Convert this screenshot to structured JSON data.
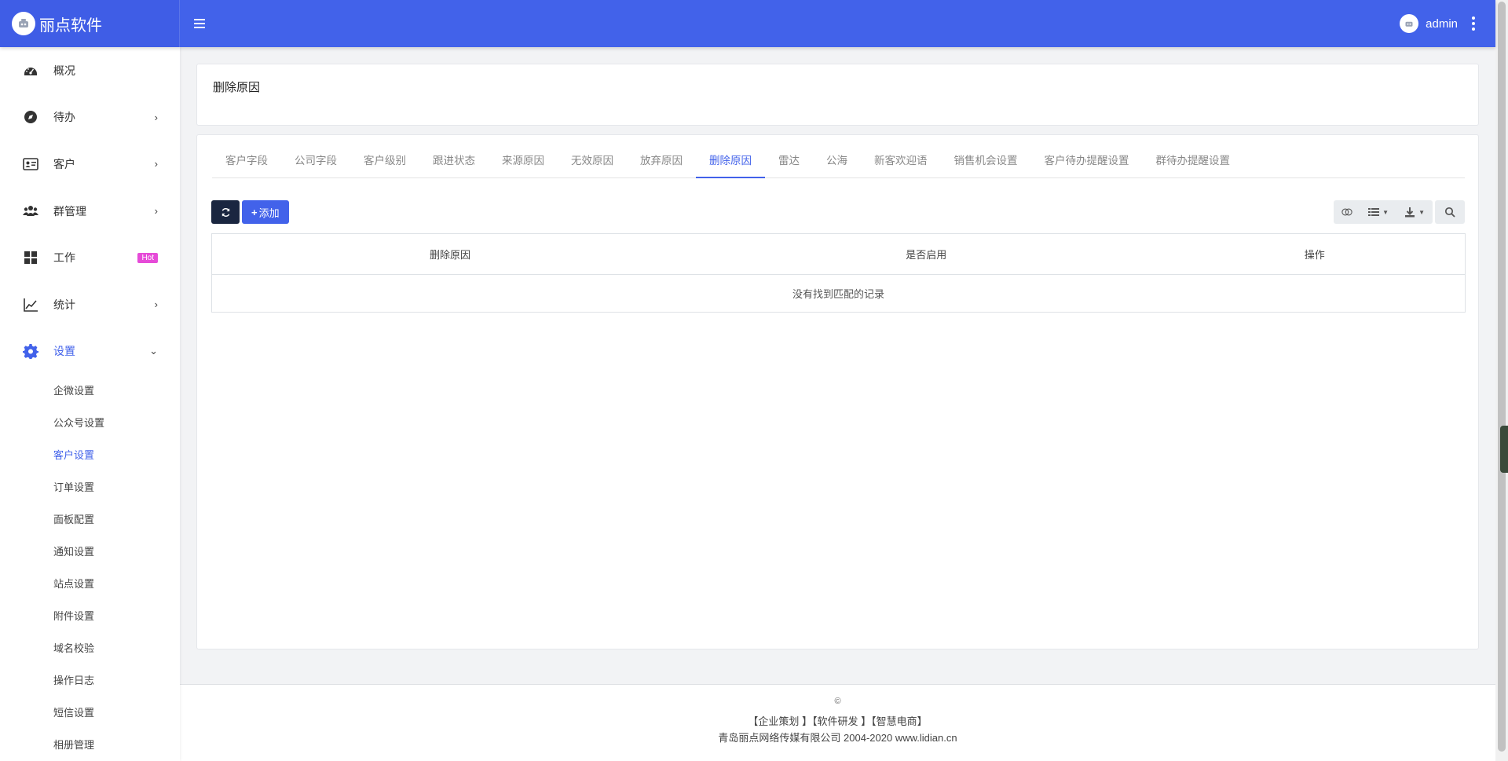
{
  "header": {
    "brand": "丽点软件",
    "username": "admin"
  },
  "sidebar": {
    "items": [
      {
        "label": "概况",
        "icon": "dashboard-icon",
        "chevron": ""
      },
      {
        "label": "待办",
        "icon": "compass-icon",
        "chevron": "›"
      },
      {
        "label": "客户",
        "icon": "id-card-icon",
        "chevron": "›"
      },
      {
        "label": "群管理",
        "icon": "users-icon",
        "chevron": "›"
      },
      {
        "label": "工作",
        "icon": "grid-icon",
        "badge": "Hot"
      },
      {
        "label": "统计",
        "icon": "line-chart-icon",
        "chevron": "›"
      },
      {
        "label": "设置",
        "icon": "gear-icon",
        "chevron": "⌄"
      }
    ],
    "sub_items": [
      "企微设置",
      "公众号设置",
      "客户设置",
      "订单设置",
      "面板配置",
      "通知设置",
      "站点设置",
      "附件设置",
      "域名校验",
      "操作日志",
      "短信设置",
      "相册管理"
    ],
    "active_sub": "客户设置"
  },
  "page": {
    "title": "删除原因"
  },
  "tabs": [
    "客户字段",
    "公司字段",
    "客户级别",
    "跟进状态",
    "来源原因",
    "无效原因",
    "放弃原因",
    "删除原因",
    "雷达",
    "公海",
    "新客欢迎语",
    "销售机会设置",
    "客户待办提醒设置",
    "群待办提醒设置"
  ],
  "active_tab": "删除原因",
  "toolbar": {
    "add_label": "添加"
  },
  "table": {
    "columns": [
      "删除原因",
      "是否启用",
      "操作"
    ],
    "empty_text": "没有找到匹配的记录"
  },
  "footer": {
    "copyright": "©",
    "links": "【企业策划 】【软件研发 】【智慧电商】",
    "company": "青岛丽点网络传媒有限公司 2004-2020 www.lidian.cn"
  },
  "colors": {
    "primary": "#4262ea",
    "hot_badge": "#e64bd8",
    "refresh_button": "#1a2640"
  }
}
